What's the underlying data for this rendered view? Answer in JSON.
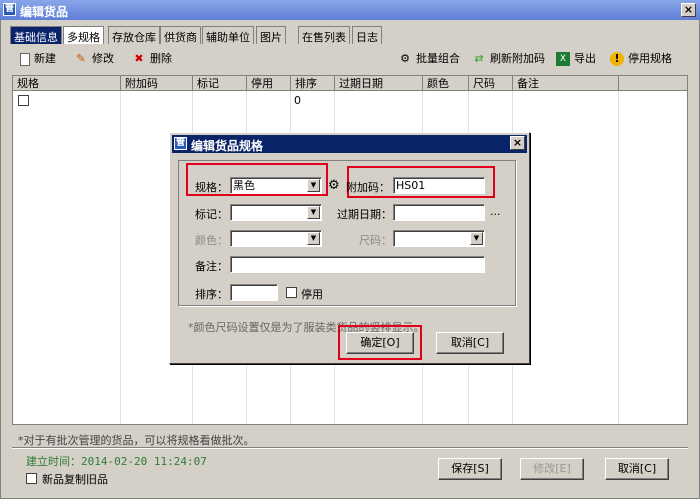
{
  "window": {
    "title": "编辑货品",
    "close_glyph": "×",
    "icon_glyph": "管"
  },
  "tabs": [
    "基础信息",
    "多规格",
    "存放仓库",
    "供货商",
    "辅助单位",
    "图片",
    "在售列表",
    "日志"
  ],
  "toolbar": {
    "new": "新建",
    "edit": "修改",
    "delete": "删除",
    "batch": "批量组合",
    "refresh_code": "刷新附加码",
    "export": "导出",
    "disable_spec": "停用规格"
  },
  "grid": {
    "columns": [
      "规格",
      "附加码",
      "标记",
      "停用",
      "排序",
      "过期日期",
      "颜色",
      "尺码",
      "备注"
    ],
    "rows": [
      {
        "sort": "0"
      }
    ]
  },
  "footer": {
    "note": "*对于有批次管理的货品，可以将规格看做批次。",
    "created_label": "建立时间：2014-02-20 11:24:07",
    "copy_old_label": "新品复制旧品",
    "save": "保存[S]",
    "modify": "修改[E]",
    "cancel": "取消[C]"
  },
  "dialog": {
    "title": "编辑货品规格",
    "spec_label": "规格：",
    "spec_value": "黑色",
    "code_label": "附加码：",
    "code_value": "HS01",
    "mark_label": "标记：",
    "expire_label": "过期日期：",
    "dots": "...",
    "color_label": "颜色：",
    "size_label": "尺码：",
    "remark_label": "备注：",
    "sort_label": "排序：",
    "disabled_label": "停用",
    "hint": "*颜色尺码设置仅是为了服装类货品的竖排显示。",
    "ok": "确定[O]",
    "cancel": "取消[C]"
  }
}
